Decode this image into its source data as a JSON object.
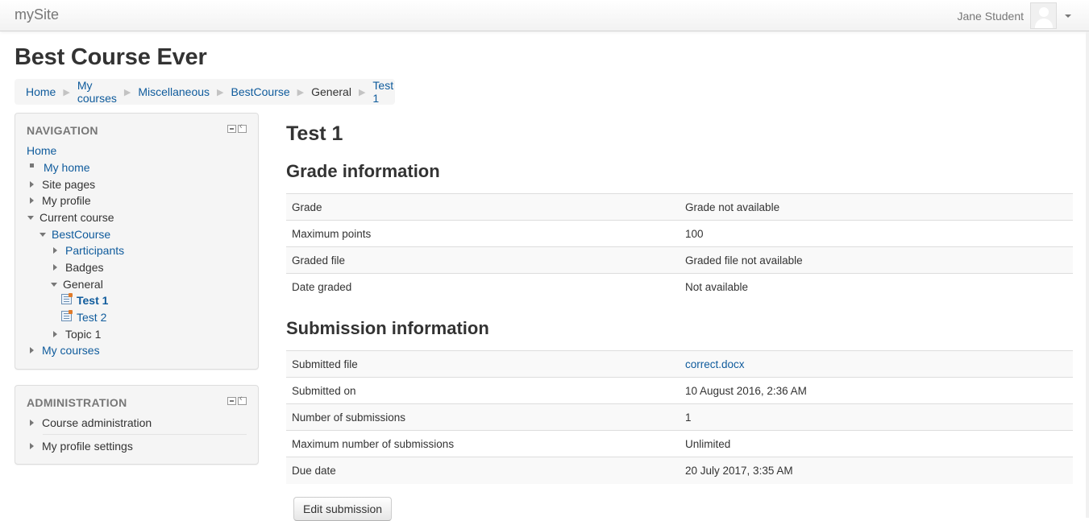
{
  "navbar": {
    "brand": "mySite",
    "user_name": "Jane Student"
  },
  "page": {
    "title": "Best Course Ever"
  },
  "breadcrumb": [
    "Home",
    "My courses",
    "Miscellaneous",
    "BestCourse",
    "General",
    "Test 1"
  ],
  "navigation_block": {
    "title": "NAVIGATION",
    "items": {
      "home": "Home",
      "my_home": "My home",
      "site_pages": "Site pages",
      "my_profile": "My profile",
      "current_course": "Current course",
      "bestcourse": "BestCourse",
      "participants": "Participants",
      "badges": "Badges",
      "general": "General",
      "test1": "Test 1",
      "test2": "Test 2",
      "topic1": "Topic 1",
      "my_courses": "My courses"
    }
  },
  "administration_block": {
    "title": "ADMINISTRATION",
    "items": {
      "course_admin": "Course administration",
      "profile_settings": "My profile settings"
    }
  },
  "main": {
    "title": "Test 1",
    "grade_section_title": "Grade information",
    "grade_rows": [
      {
        "label": "Grade",
        "value": "Grade not available"
      },
      {
        "label": "Maximum points",
        "value": "100"
      },
      {
        "label": "Graded file",
        "value": "Graded file not available"
      },
      {
        "label": "Date graded",
        "value": "Not available"
      }
    ],
    "submission_section_title": "Submission information",
    "submission_rows": [
      {
        "label": "Submitted file",
        "value": "correct.docx"
      },
      {
        "label": "Submitted on",
        "value": "10 August 2016, 2:36 AM"
      },
      {
        "label": "Number of submissions",
        "value": "1"
      },
      {
        "label": "Maximum number of submissions",
        "value": "Unlimited"
      },
      {
        "label": "Due date",
        "value": "20 July 2017, 3:35 AM"
      }
    ],
    "edit_button": "Edit submission"
  },
  "colors": {
    "link": "#0f5b9c",
    "text": "#333333",
    "muted": "#777777",
    "block_bg": "#f5f5f5"
  }
}
